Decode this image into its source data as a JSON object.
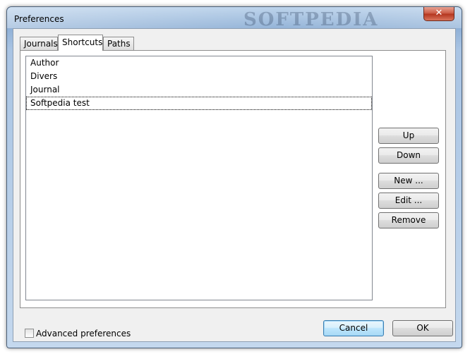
{
  "window": {
    "title": "Preferences",
    "close_glyph": "✕"
  },
  "watermark": "SOFTPEDIA",
  "tabs": [
    {
      "label": "Journals",
      "active": false
    },
    {
      "label": "Shortcuts",
      "active": true
    },
    {
      "label": "Paths",
      "active": false
    }
  ],
  "list": {
    "items": [
      "Author",
      "Divers",
      "Journal",
      "Softpedia test"
    ],
    "focused_index": 3
  },
  "buttons": {
    "up": "Up",
    "down": "Down",
    "new": "New ...",
    "edit": "Edit ...",
    "remove": "Remove",
    "cancel": "Cancel",
    "ok": "OK"
  },
  "advanced": {
    "label": "Advanced preferences",
    "checked": false
  },
  "colors": {
    "titlebar": "#a9c4e3",
    "close": "#c9553f",
    "default_button": "#3c7fb1"
  }
}
